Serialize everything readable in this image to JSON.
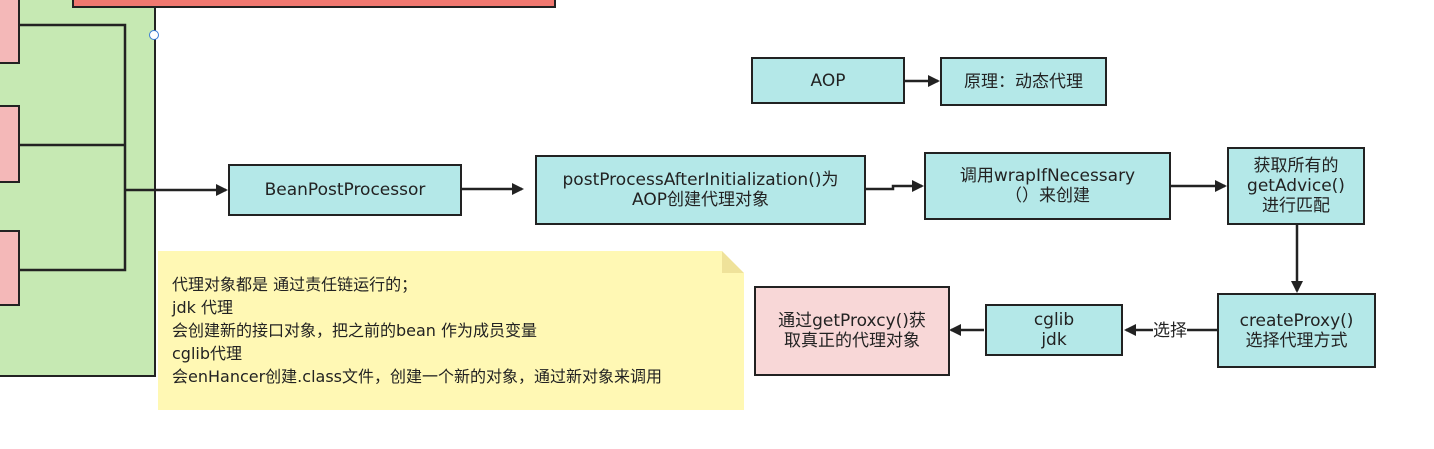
{
  "diagram": {
    "nodes": {
      "aop": "AOP",
      "principle": "原理：动态代理",
      "bean_post_processor": "BeanPostProcessor",
      "post_process": [
        "postProcessAfterInitialization()为",
        "AOP创建代理对象"
      ],
      "wrap": [
        "调用wrapIfNecessary",
        "（）来创建"
      ],
      "get_advice": [
        "获取所有的",
        "getAdvice()",
        "进行匹配"
      ],
      "create_proxy": [
        "createProxy()",
        "选择代理方式"
      ],
      "cglib_jdk": [
        "cglib",
        "jdk"
      ],
      "get_proxy": [
        "通过getProxcy()获",
        "取真正的代理对象"
      ]
    },
    "edge_labels": {
      "choose": "选择"
    },
    "note": {
      "lines": [
        "代理对象都是 通过责任链运行的；",
        "jdk 代理",
        "会创建新的接口对象，把之前的bean 作为成员变量",
        "cglib代理",
        "会enHancer创建.class文件，创建一个新的对象，通过新对象来调用"
      ]
    },
    "colors": {
      "node_fill": "#b4e8e8",
      "result_fill": "#f8d7d7",
      "panel_fill": "#c6e9b3",
      "note_fill": "#fff8b4",
      "bar_fill": "#f07870",
      "stroke": "#222222"
    }
  }
}
